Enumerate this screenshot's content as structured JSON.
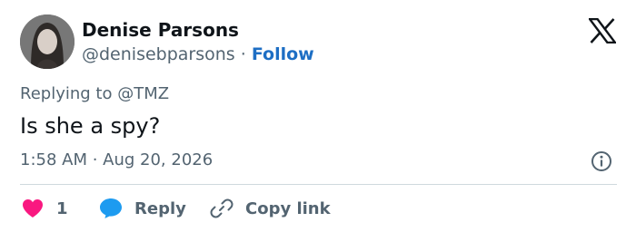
{
  "author": {
    "display_name": "Denise Parsons",
    "handle": "@denisebparsons",
    "separator": "·",
    "follow_label": "Follow"
  },
  "tweet": {
    "replying_prefix": "Replying to",
    "replying_to": "@TMZ",
    "text": "Is she a spy?",
    "timestamp": "1:58 AM · Aug 20, 2026"
  },
  "actions": {
    "like_count": "1",
    "reply_label": "Reply",
    "copy_link_label": "Copy link"
  },
  "icons": {
    "logo": "x-logo-icon",
    "info": "info-icon",
    "like": "heart-icon",
    "reply": "speech-bubble-icon",
    "copy": "link-icon"
  },
  "colors": {
    "heart": "#f91880",
    "reply_bubble": "#1d9bf0",
    "follow": "#1d6ec4",
    "muted": "#536471",
    "text": "#0f1419"
  }
}
